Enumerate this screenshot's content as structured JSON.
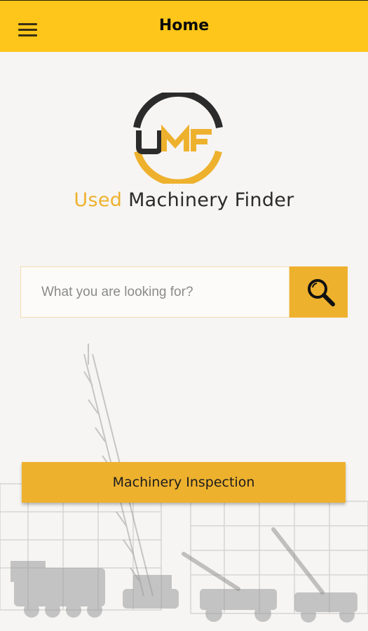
{
  "header": {
    "title": "Home",
    "menu_icon": "hamburger-menu-icon"
  },
  "logo": {
    "monogram": "UMF",
    "accent_color": "#eeb12e",
    "dark_color": "#2b2b2b"
  },
  "brand": {
    "used": "Used",
    "rest": " Machinery Finder"
  },
  "search": {
    "placeholder": "What you are looking for?",
    "value": "",
    "icon": "search-icon"
  },
  "inspection_button": {
    "label": "Machinery Inspection"
  },
  "colors": {
    "appbar": "#fec61a",
    "accent": "#eeb12e",
    "background": "#f6f5f3"
  }
}
